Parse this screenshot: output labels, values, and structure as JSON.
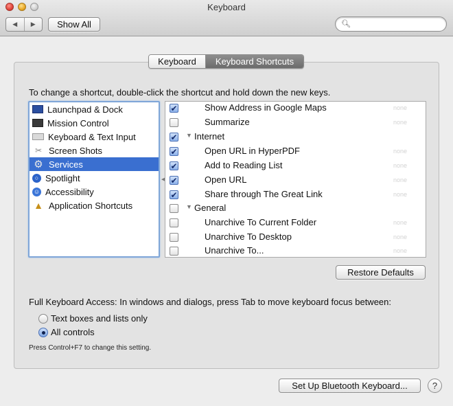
{
  "window": {
    "title": "Keyboard"
  },
  "toolbar": {
    "back_label": "◀",
    "forward_label": "▶",
    "show_all_label": "Show All",
    "search_placeholder": ""
  },
  "tabs": [
    {
      "label": "Keyboard",
      "selected": false
    },
    {
      "label": "Keyboard Shortcuts",
      "selected": true
    }
  ],
  "instructions": "To change a shortcut, double-click the shortcut and hold down the new keys.",
  "categories": [
    {
      "label": "Launchpad & Dock",
      "icon": "launchpad-icon",
      "selected": false
    },
    {
      "label": "Mission Control",
      "icon": "mission-control-icon",
      "selected": false
    },
    {
      "label": "Keyboard & Text Input",
      "icon": "keyboard-icon",
      "selected": false
    },
    {
      "label": "Screen Shots",
      "icon": "screenshot-icon",
      "selected": false
    },
    {
      "label": "Services",
      "icon": "gear-icon",
      "selected": true
    },
    {
      "label": "Spotlight",
      "icon": "spotlight-icon",
      "selected": false
    },
    {
      "label": "Accessibility",
      "icon": "accessibility-icon",
      "selected": false
    },
    {
      "label": "Application Shortcuts",
      "icon": "app-shortcuts-icon",
      "selected": false
    }
  ],
  "shortcuts": [
    {
      "label": "Show Address in Google Maps",
      "checked": true,
      "type": "item",
      "shortcut": "none"
    },
    {
      "label": "Summarize",
      "checked": false,
      "type": "item",
      "shortcut": "none"
    },
    {
      "label": "Internet",
      "checked": true,
      "type": "group",
      "shortcut": ""
    },
    {
      "label": "Open URL in HyperPDF",
      "checked": true,
      "type": "item",
      "shortcut": "none"
    },
    {
      "label": "Add to Reading List",
      "checked": true,
      "type": "item",
      "shortcut": "none"
    },
    {
      "label": "Open URL",
      "checked": true,
      "type": "item",
      "shortcut": "none"
    },
    {
      "label": "Share through The Great Link",
      "checked": true,
      "type": "item",
      "shortcut": "none"
    },
    {
      "label": "General",
      "checked": false,
      "type": "group",
      "shortcut": ""
    },
    {
      "label": "Unarchive To Current Folder",
      "checked": false,
      "type": "item",
      "shortcut": "none"
    },
    {
      "label": "Unarchive To Desktop",
      "checked": false,
      "type": "item",
      "shortcut": "none"
    },
    {
      "label": "Unarchive To...",
      "checked": false,
      "type": "item",
      "shortcut": "none"
    }
  ],
  "restore_defaults_label": "Restore Defaults",
  "full_keyboard_access": {
    "label": "Full Keyboard Access: In windows and dialogs, press Tab to move keyboard focus between:",
    "options": [
      {
        "label": "Text boxes and lists only",
        "selected": false
      },
      {
        "label": "All controls",
        "selected": true
      }
    ],
    "hint": "Press Control+F7 to change this setting."
  },
  "bluetooth_button_label": "Set Up Bluetooth Keyboard...",
  "help_label": "?"
}
